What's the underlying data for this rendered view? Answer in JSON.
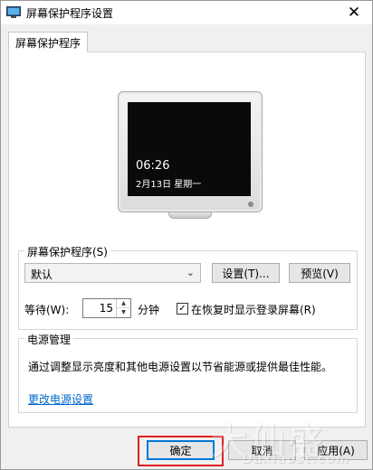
{
  "window": {
    "title": "屏幕保护程序设置",
    "close_glyph": "✕"
  },
  "tabs": [
    {
      "label": "屏幕保护程序",
      "active": true
    }
  ],
  "preview": {
    "time": "06:26",
    "date": "2月13日  星期一"
  },
  "screensaver": {
    "group_label": "屏幕保护程序(S)",
    "selected": "默认",
    "settings_button": "设置(T)...",
    "preview_button": "预览(V)",
    "wait_label": "等待(W):",
    "wait_value": "15",
    "wait_unit": "分钟",
    "resume_checkbox_label": "在恢复时显示登录屏幕(R)",
    "resume_checked": true
  },
  "power": {
    "group_label": "电源管理",
    "description": "通过调整显示亮度和其他电源设置以节省能源或提供最佳性能。",
    "link": "更改电源设置"
  },
  "buttons": {
    "ok": "确定",
    "cancel": "取消",
    "apply": "应用(A)"
  },
  "watermark": {
    "big": "大仙盛",
    "small": "Daxiaost.com"
  },
  "colors": {
    "accent": "#0078d7",
    "link": "#0066cc",
    "highlight": "#e02020"
  }
}
